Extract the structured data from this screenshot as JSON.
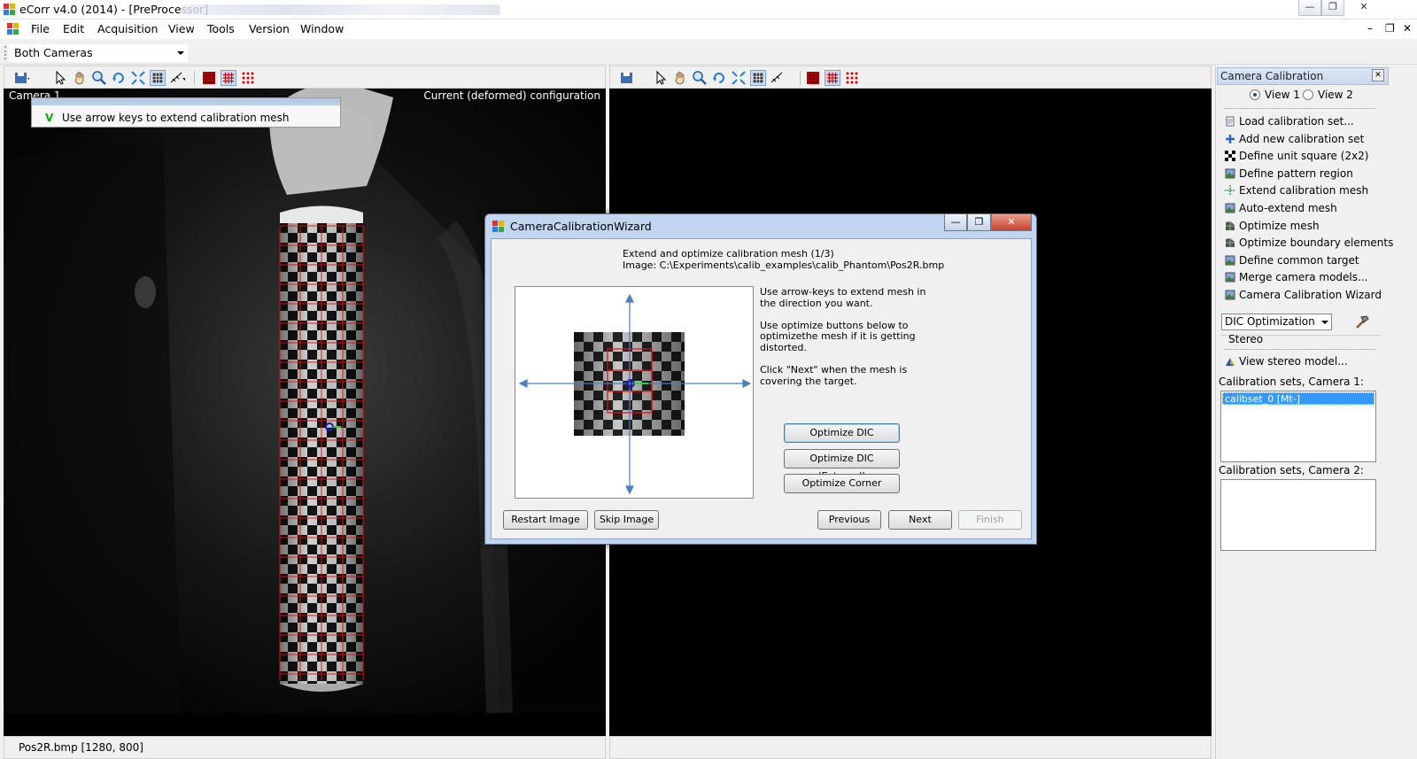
{
  "window": {
    "title": "eCorr v4.0 (2014) - [PreProcessor]",
    "controls": [
      "—",
      "❐",
      "✕"
    ],
    "mdi_controls": [
      "–",
      "❐",
      "✕"
    ]
  },
  "menu": [
    "File",
    "Edit",
    "Acquisition",
    "View",
    "Tools",
    "Version",
    "Window"
  ],
  "camera_selector": {
    "value": "Both Cameras"
  },
  "left_view": {
    "camera_label": "Camera 1",
    "config_label": "Current (deformed) configuration",
    "hint_check": "V",
    "hint_text": "Use arrow keys to extend calibration mesh",
    "status": "Pos2R.bmp [1280, 800]"
  },
  "dialog": {
    "title": "CameraCalibrationWizard",
    "controls": [
      "—",
      "❐",
      "✕"
    ],
    "step_title": "Extend and optimize calibration mesh (1/3)",
    "image_path": "Image: C:\\Experiments\\calib_examples\\calib_Phantom\\Pos2R.bmp",
    "instructions": [
      "Use arrow-keys to extend mesh in",
      "the direction you want.",
      "",
      "Use optimize buttons below to",
      "optimizethe mesh if it is getting",
      "distorted.",
      "",
      "Click \"Next\" when the mesh is",
      "covering the target."
    ],
    "buttons": {
      "optimize_dic": "Optimize DIC",
      "optimize_dic_external": "Optimize DIC (External)",
      "optimize_corner": "Optimize Corner",
      "restart_image": "Restart Image",
      "skip_image": "Skip Image",
      "previous": "Previous",
      "next": "Next",
      "finish": "Finish"
    }
  },
  "dock": {
    "title": "Camera Calibration",
    "close": "✕",
    "view_options": [
      {
        "label": "View 1",
        "selected": true
      },
      {
        "label": "View 2",
        "selected": false
      }
    ],
    "actions": [
      {
        "label": "Load calibration set...",
        "icon": "document-icon"
      },
      {
        "label": "Add new calibration set",
        "icon": "plus-icon"
      },
      {
        "label": "Define unit square (2x2)",
        "icon": "checker-icon"
      },
      {
        "label": "Define pattern region",
        "icon": "image-icon"
      },
      {
        "label": "Extend calibration mesh",
        "icon": "extend-icon"
      },
      {
        "label": "Auto-extend mesh",
        "icon": "image-icon"
      },
      {
        "label": "Optimize mesh",
        "icon": "mesh-icon"
      },
      {
        "label": "Optimize boundary elements",
        "icon": "mesh-icon"
      },
      {
        "label": "Define common target",
        "icon": "image-icon"
      },
      {
        "label": "Merge camera models...",
        "icon": "image-icon"
      },
      {
        "label": "Camera Calibration Wizard",
        "icon": "image-icon"
      }
    ],
    "method_selector": "DIC Optimization",
    "stereo_label": "Stereo",
    "view_stereo": "View stereo model...",
    "cam1_sets_label": "Calibration sets, Camera 1:",
    "cam1_sets": [
      "calibset_0 [Mt-]"
    ],
    "cam2_sets_label": "Calibration sets, Camera 2:",
    "cam2_sets": []
  },
  "colors": {
    "mesh": "#e01010",
    "selection": "#3399ff",
    "dialog_frame": "#c1d5ee",
    "arrow": "#4a7fc0"
  }
}
